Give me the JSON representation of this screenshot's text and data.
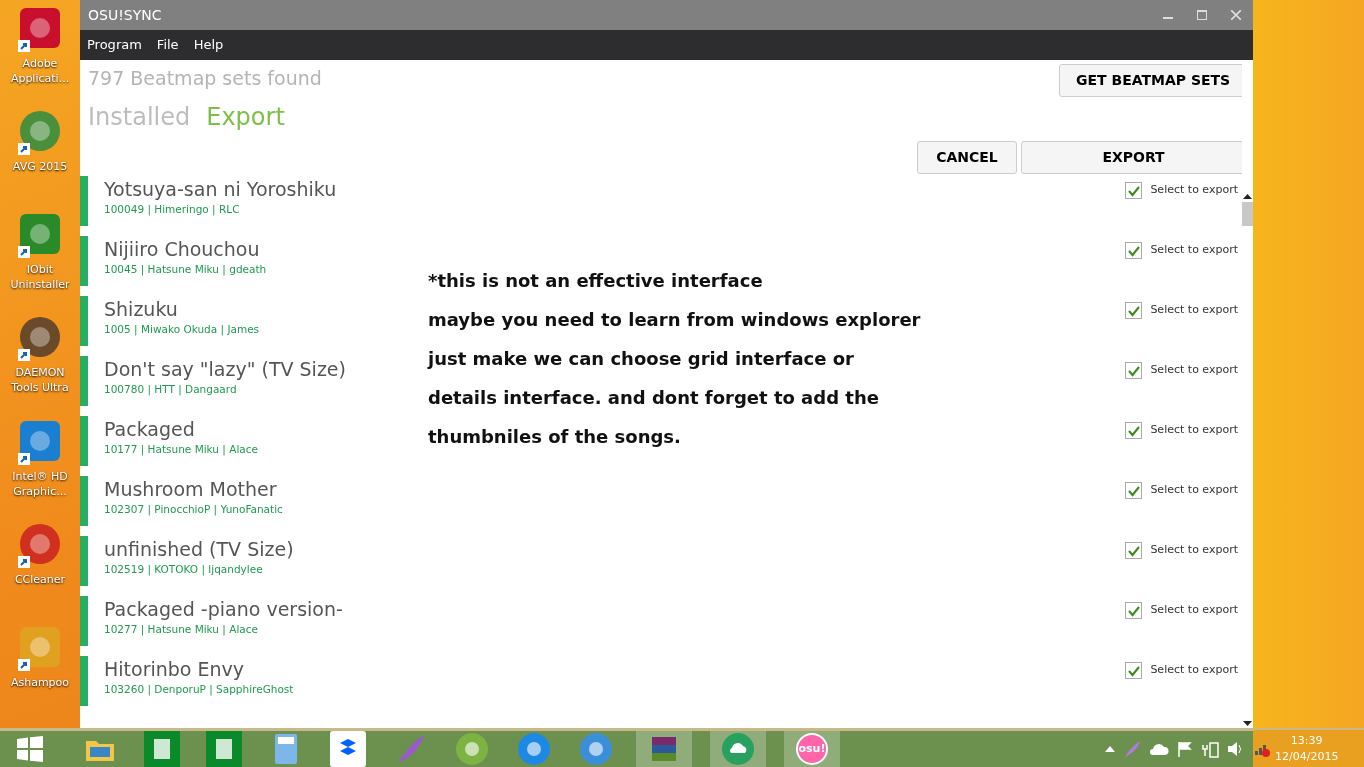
{
  "desktop_icons": [
    {
      "label": "Adobe Applicati...",
      "color": "#c8102e"
    },
    {
      "label": "AVG 2015",
      "color": "#4a8f3c"
    },
    {
      "label": "IObit Uninstaller",
      "color": "#2a8a2a"
    },
    {
      "label": "DAEMON Tools Ultra",
      "color": "#6b4a2a"
    },
    {
      "label": "Intel® HD Graphic...",
      "color": "#1a7fd0"
    },
    {
      "label": "CCleaner",
      "color": "#d03020"
    },
    {
      "label": "Ashampoo",
      "color": "#e0a020"
    }
  ],
  "window": {
    "title": "OSU!SYNC"
  },
  "menu": [
    "Program",
    "File",
    "Help"
  ],
  "count_text": "797 Beatmap sets found",
  "get_button": "GET BEATMAP SETS",
  "tabs": [
    {
      "label": "Installed",
      "selected": false
    },
    {
      "label": "Export",
      "selected": true
    }
  ],
  "actions": [
    "CANCEL",
    "EXPORT"
  ],
  "beatmaps": [
    {
      "title": "Yotsuya-san ni Yoroshiku",
      "info": "100049 | Himeringo | RLC",
      "checked": true,
      "check_label": "Select to export"
    },
    {
      "title": "Nijiiro Chouchou",
      "info": "10045 | Hatsune Miku | gdeath",
      "checked": true,
      "check_label": "Select to export"
    },
    {
      "title": "Shizuku",
      "info": "1005 | Miwako Okuda | James",
      "checked": true,
      "check_label": "Select to export"
    },
    {
      "title": "Don't say \"lazy\" (TV Size)",
      "info": "100780 | HTT | Dangaard",
      "checked": true,
      "check_label": "Select to export"
    },
    {
      "title": "Packaged",
      "info": "10177 | Hatsune Miku | Alace",
      "checked": true,
      "check_label": "Select to export"
    },
    {
      "title": "Mushroom Mother",
      "info": "102307 | PinocchioP | YunoFanatic",
      "checked": true,
      "check_label": "Select to export"
    },
    {
      "title": "unfinished (TV Size)",
      "info": "102519 | KOTOKO | ljqandylee",
      "checked": true,
      "check_label": "Select to export"
    },
    {
      "title": "Packaged -piano version-",
      "info": "10277 | Hatsune Miku | Alace",
      "checked": true,
      "check_label": "Select to export"
    },
    {
      "title": "Hitorinbo Envy",
      "info": "103260 | DenporuP | SapphireGhost",
      "checked": true,
      "check_label": "Select to export"
    }
  ],
  "annotation": [
    "*this is not an effective interface",
    "maybe you need to learn from windows explorer",
    "just make we can choose grid interface or",
    "details interface. and dont forget to add the",
    "thumbniles of the songs."
  ],
  "taskbar": {
    "apps": [
      {
        "kind": "folder"
      },
      {
        "kind": "tile"
      },
      {
        "kind": "tile"
      },
      {
        "kind": "calculator"
      },
      {
        "kind": "box"
      },
      {
        "kind": "feather"
      },
      {
        "kind": "round",
        "color": "#7cb342"
      },
      {
        "kind": "round",
        "color": "#1e88e5"
      },
      {
        "kind": "round",
        "color": "#3b8fd9"
      },
      {
        "kind": "books"
      },
      {
        "kind": "cloud"
      },
      {
        "kind": "osu",
        "label": "osu!"
      }
    ],
    "time": "13:39",
    "date": "12/04/2015"
  }
}
